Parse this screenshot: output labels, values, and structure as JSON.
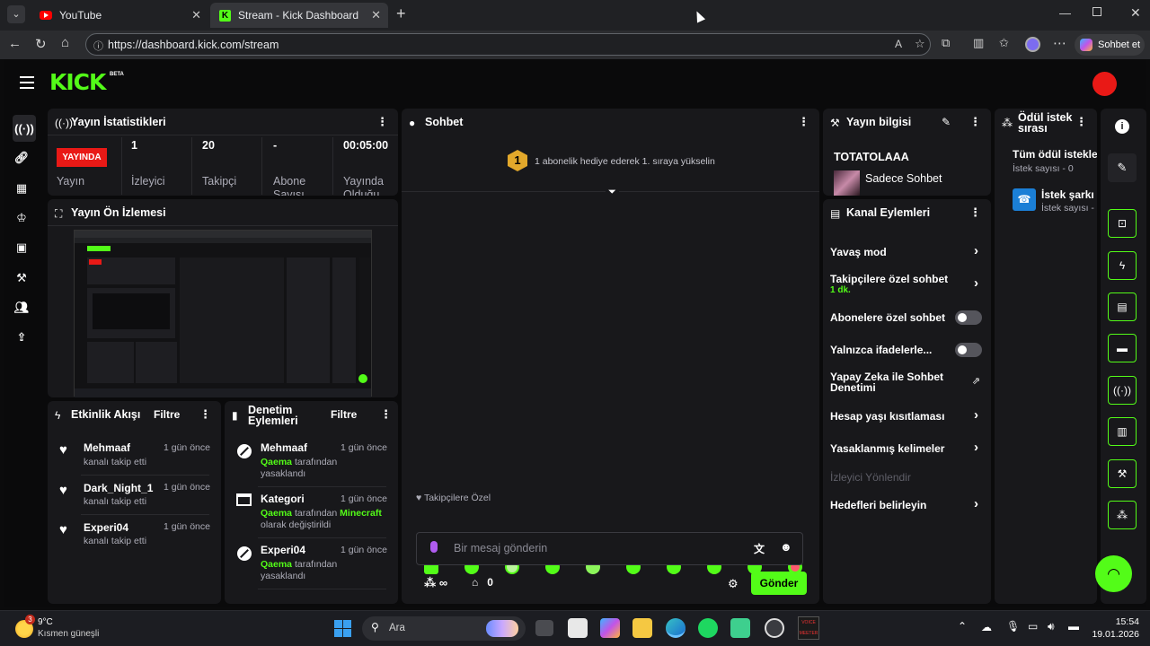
{
  "browser": {
    "tabs": [
      {
        "title": "YouTube"
      },
      {
        "title": "Stream - Kick Dashboard"
      }
    ],
    "url": "https://dashboard.kick.com/stream",
    "copilot_label": "Sohbet et"
  },
  "brand": {
    "logo": "KICK",
    "beta": "BETA",
    "accent": "#53fc18",
    "live_red": "#e91916"
  },
  "stats": {
    "title": "Yayın İstatistikleri",
    "live_badge": "YAYINDA",
    "live_label": "Yayın",
    "viewers": "1",
    "viewers_label": "İzleyici",
    "followers": "20",
    "followers_label": "Takipçi",
    "subs": "-",
    "subs_label": "Abone Sayısı",
    "uptime": "00:05:00",
    "uptime_label": "Yayında Olduğu"
  },
  "preview": {
    "title": "Yayın Ön İzlemesi"
  },
  "activity": {
    "title": "Etkinlik Akışı",
    "filter": "Filtre",
    "items": [
      {
        "user": "Mehmaaf",
        "time": "1 gün önce",
        "text": "kanalı takip etti"
      },
      {
        "user": "Dark_Night_1",
        "time": "1 gün önce",
        "text": "kanalı takip etti"
      },
      {
        "user": "Experi04",
        "time": "1 gün önce",
        "text": "kanalı takip etti"
      }
    ]
  },
  "moderation": {
    "title": "Denetim Eylemleri",
    "filter": "Filtre",
    "items": [
      {
        "user": "Mehmaaf",
        "time": "1 gün önce",
        "actor": "Qaema",
        "line1": " tarafından",
        "line2": "yasaklandı"
      },
      {
        "user": "Kategori",
        "time": "1 gün önce",
        "actor": "Qaema",
        "line1": " tarafından ",
        "target": "Minecraft",
        "line2": "olarak değiştirildi"
      },
      {
        "user": "Experi04",
        "time": "1 gün önce",
        "actor": "Qaema",
        "line1": " tarafından",
        "line2": "yasaklandı"
      }
    ]
  },
  "chat": {
    "title": "Sohbet",
    "rank": "1",
    "gift_prompt": "1 abonelik hediye ederek 1. sıraya yükselin",
    "followers_only": "Takipçilere Özel",
    "placeholder": "Bir mesaj gönderin",
    "points": "∞",
    "store_count": "0",
    "send": "Gönder"
  },
  "stream_info": {
    "title": "Yayın bilgisi",
    "stream_title": "TOTATOLAAA",
    "category": "Sadece Sohbet"
  },
  "channel_actions": {
    "title": "Kanal Eylemleri",
    "slow_mode": "Yavaş mod",
    "followers_chat": "Takipçilere özel sohbet",
    "followers_chat_value": "1 dk.",
    "subs_chat": "Abonelere özel sohbet",
    "emotes_only": "Yalnızca ifadelerle...",
    "ai_moderation": "Yapay Zeka ile Sohbet Denetimi",
    "age_restriction": "Hesap yaşı kısıtlaması",
    "banned_words": "Yasaklanmış kelimeler",
    "raid": "İzleyici Yönlendir",
    "goals": "Hedefleri belirleyin"
  },
  "rewards": {
    "title": "Ödül istek sırası",
    "all_requests": "Tüm ödül istekleri",
    "all_count": "İstek sayısı - 0",
    "song_request": "İstek şarkı",
    "song_count": "İstek sayısı -"
  },
  "taskbar": {
    "temp": "9°C",
    "weather": "Kısmen güneşli",
    "weather_badge": "3",
    "search": "Ara",
    "time": "15:54",
    "date": "19.01.2026",
    "voicemeeter": "VOICE MEETER"
  }
}
